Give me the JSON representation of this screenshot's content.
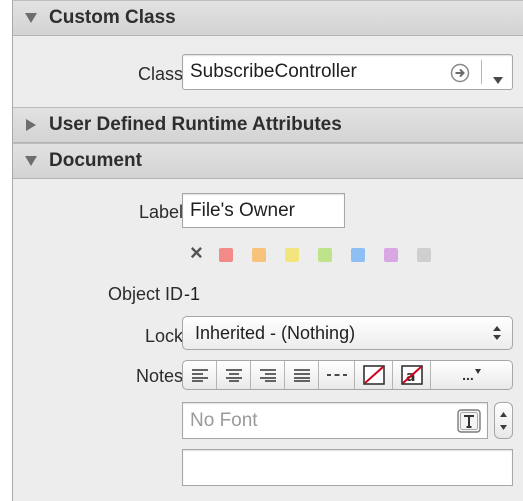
{
  "sections": {
    "custom_class": {
      "title": "Custom Class",
      "expanded": true
    },
    "runtime_attributes": {
      "title": "User Defined Runtime Attributes",
      "expanded": false
    },
    "document": {
      "title": "Document",
      "expanded": true
    }
  },
  "custom_class": {
    "class_label": "Class",
    "class_value": "SubscribeController"
  },
  "document": {
    "label_label": "Label",
    "label_value": "File's Owner",
    "clear_label_glyph": "×",
    "label_colors": [
      "#f38a8a",
      "#f7c27a",
      "#f3e57d",
      "#bde48a",
      "#8ebff2",
      "#d9a8e3",
      "#cfcfcf"
    ],
    "object_id_label": "Object ID",
    "object_id_value": "-1",
    "lock_label": "Lock",
    "lock_value": "Inherited - (Nothing)",
    "notes_label": "Notes",
    "font_placeholder": "No Font",
    "more_glyph": "..."
  }
}
